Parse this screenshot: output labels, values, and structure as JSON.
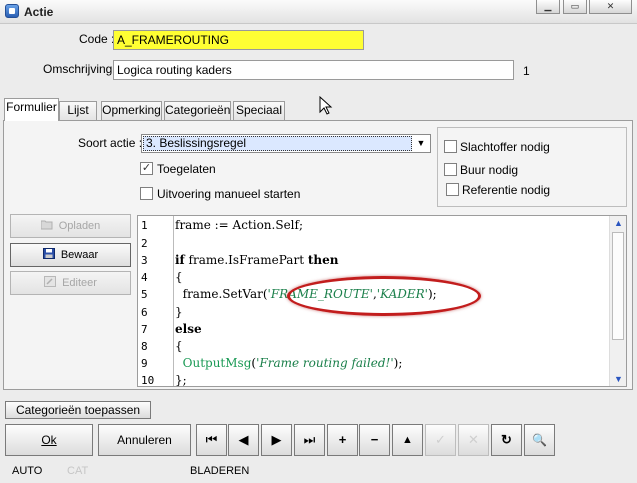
{
  "window": {
    "title": "Actie"
  },
  "form": {
    "code_label": "Code :",
    "code_value": "A_FRAMEROUTING",
    "desc_label": "Omschrijving :",
    "desc_value": "Logica routing kaders",
    "desc_count": "1"
  },
  "tabs": [
    "Formulier",
    "Lijst",
    "Opmerking",
    "Categorieën",
    "Speciaal"
  ],
  "formulier": {
    "soort_label": "Soort actie :",
    "soort_value": "3.  Beslissingsregel",
    "toegelaten_label": "Toegelaten",
    "toegelaten_checked": true,
    "manueel_label": "Uitvoering manueel starten",
    "slachtoffer_label": "Slachtoffer nodig",
    "buur_label": "Buur nodig",
    "referentie_label": "Referentie nodig"
  },
  "side_buttons": {
    "opladen": "Opladen",
    "bewaar": "Bewaar",
    "editeer": "Editeer"
  },
  "editor": {
    "line_numbers": [
      "1",
      "2",
      "3",
      "4",
      "5",
      "6",
      "7",
      "8",
      "9",
      "10"
    ],
    "lines": {
      "l1_a": "frame := Action.Self;",
      "l3_kw1": "if",
      "l3_mid": " frame.IsFramePart ",
      "l3_kw2": "then",
      "l4": "{",
      "l5_a": "  frame.SetVar(",
      "l5_s1": "'FRAME_ROUTE'",
      "l5_c": ",",
      "l5_s2": "'KADER'",
      "l5_e": ");",
      "l6": "}",
      "l7": "else",
      "l8": "{",
      "l9_fn": "  OutputMsg",
      "l9_p": "(",
      "l9_s": "'Frame routing failed!'",
      "l9_e": ");",
      "l10": "};"
    }
  },
  "toolbar": {
    "categorieen_toepassen": "Categorieën toepassen",
    "ok": "Ok",
    "annuleren": "Annuleren",
    "nav": {
      "first": "⏮",
      "prev": "◀",
      "next": "▶",
      "last": "⏭",
      "add": "+",
      "remove": "−",
      "up": "▲",
      "confirm": "✓",
      "cancel": "✕",
      "refresh": "↻",
      "find": "🔍"
    }
  },
  "status": {
    "mode": "AUTO",
    "cat": "CAT",
    "state": "BLADEREN"
  }
}
